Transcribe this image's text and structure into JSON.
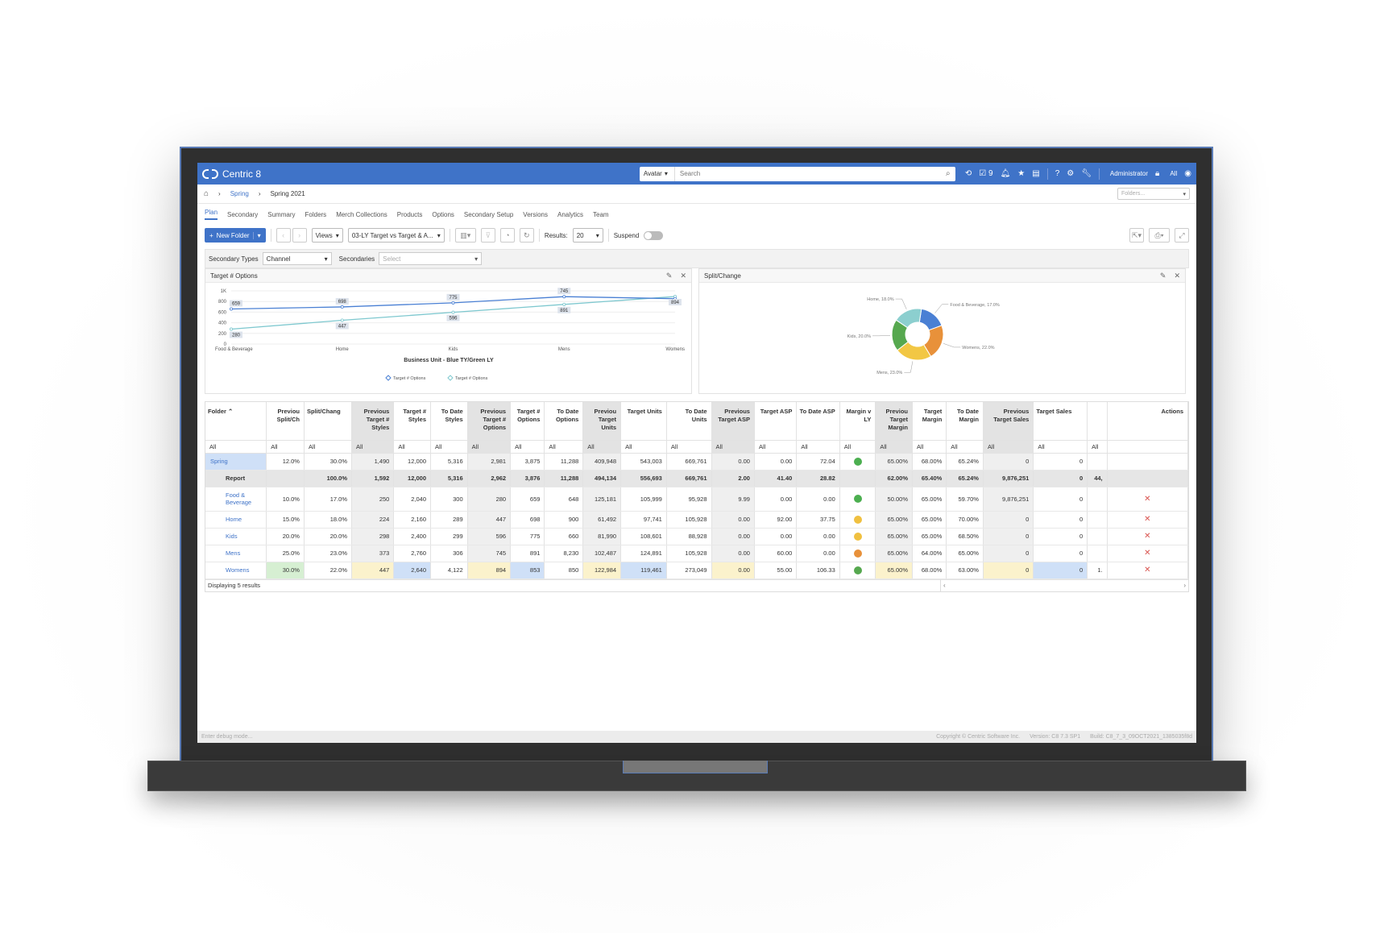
{
  "app": {
    "title": "Centric 8"
  },
  "search": {
    "scope": "Avatar",
    "placeholder": "Search"
  },
  "topbar": {
    "notification_count": "9",
    "user": "Administrator",
    "lock_scope": "All"
  },
  "breadcrumb": {
    "season": "Spring",
    "current": "Spring 2021",
    "folders_placeholder": "Folders..."
  },
  "tabs": [
    "Plan",
    "Secondary",
    "Summary",
    "Folders",
    "Merch Collections",
    "Products",
    "Options",
    "Secondary Setup",
    "Versions",
    "Analytics",
    "Team"
  ],
  "toolbar": {
    "new_folder": "New Folder",
    "views_label": "Views",
    "view_value": "03-LY Target vs Target & A...",
    "results_label": "Results:",
    "results_value": "20",
    "suspend_label": "Suspend"
  },
  "filters": {
    "secondary_types_label": "Secondary Types",
    "secondary_types_value": "Channel",
    "secondaries_label": "Secondaries",
    "secondaries_placeholder": "Select"
  },
  "line_panel": {
    "title": "Target # Options"
  },
  "pie_panel": {
    "title": "Split/Change"
  },
  "chart_data": [
    {
      "type": "line",
      "title": "Business Unit - Blue TY/Green LY",
      "categories": [
        "Food & Beverage",
        "Home",
        "Kids",
        "Mens",
        "Womens"
      ],
      "y_ticks": [
        "0",
        "200",
        "400",
        "600",
        "800",
        "1K"
      ],
      "ylim": [
        0,
        1000
      ],
      "grid": true,
      "legend_position": "bottom",
      "legend": [
        "Target # Options",
        "Target # Options"
      ],
      "series": [
        {
          "name": "Target # Options",
          "color": "#4a80d4",
          "values": [
            659,
            698,
            775,
            891,
            853
          ]
        },
        {
          "name": "Target # Options",
          "color": "#7ec8cf",
          "values": [
            280,
            447,
            596,
            745,
            894
          ]
        }
      ],
      "data_labels": [
        {
          "series": 0,
          "index": 0,
          "text": "659"
        },
        {
          "series": 1,
          "index": 0,
          "text": "280"
        },
        {
          "series": 0,
          "index": 1,
          "text": "698"
        },
        {
          "series": 1,
          "index": 1,
          "text": "447"
        },
        {
          "series": 0,
          "index": 2,
          "text": "775"
        },
        {
          "series": 1,
          "index": 2,
          "text": "596"
        },
        {
          "series": 0,
          "index": 3,
          "text": "745"
        },
        {
          "series": 1,
          "index": 3,
          "text": "891"
        },
        {
          "series": 1,
          "index": 4,
          "text": "894"
        }
      ]
    },
    {
      "type": "pie",
      "slices": [
        {
          "label": "Food & Beverage, 17.0%",
          "value": 17.0,
          "color": "#4a80d4"
        },
        {
          "label": "Womens, 22.0%",
          "value": 22.0,
          "color": "#e8913a"
        },
        {
          "label": "Mens, 23.0%",
          "value": 23.0,
          "color": "#f2c744"
        },
        {
          "label": "Kids, 20.0%",
          "value": 20.0,
          "color": "#56a84f"
        },
        {
          "label": "Home, 18.0%",
          "value": 18.0,
          "color": "#8ccfcf"
        }
      ]
    }
  ],
  "grid": {
    "columns": [
      {
        "label": "Folder",
        "shade": false
      },
      {
        "label": "Previou Split/Ch",
        "shade": false
      },
      {
        "label": "Split/Chang",
        "shade": false
      },
      {
        "label": "Previous Target # Styles",
        "shade": true
      },
      {
        "label": "Target # Styles",
        "shade": false
      },
      {
        "label": "To Date Styles",
        "shade": false
      },
      {
        "label": "Previous Target # Options",
        "shade": true
      },
      {
        "label": "Target # Options",
        "shade": false
      },
      {
        "label": "To Date Options",
        "shade": false
      },
      {
        "label": "Previou Target Units",
        "shade": true
      },
      {
        "label": "Target Units",
        "shade": false
      },
      {
        "label": "To Date Units",
        "shade": false
      },
      {
        "label": "Previous Target ASP",
        "shade": true
      },
      {
        "label": "Target ASP",
        "shade": false
      },
      {
        "label": "To Date ASP",
        "shade": false
      },
      {
        "label": "Margin v LY",
        "shade": false
      },
      {
        "label": "Previou Target Margin",
        "shade": true
      },
      {
        "label": "Target Margin",
        "shade": false
      },
      {
        "label": "To Date Margin",
        "shade": false
      },
      {
        "label": "Previous Target Sales",
        "shade": true
      },
      {
        "label": "Target Sales",
        "shade": false
      },
      {
        "label": "",
        "shade": false
      },
      {
        "label": "Actions",
        "shade": false
      }
    ],
    "filter_value": "All",
    "footer": "Displaying 5 results",
    "rows": [
      {
        "name": "Spring",
        "kind": "top",
        "cells": [
          "12.0%",
          "30.0%",
          "1,490",
          "12,000",
          "5,316",
          "2,981",
          "3,875",
          "11,288",
          "409,948",
          "543,003",
          "669,761",
          "0.00",
          "0.00",
          "72.04",
          "",
          "65.00%",
          "68.00%",
          "65.24%",
          "0",
          "0",
          "",
          ""
        ],
        "margin_icon": "arrow-up-icon",
        "margin_color": "#4caf50"
      },
      {
        "name": "Report",
        "kind": "report",
        "cells": [
          "",
          "100.0%",
          "1,592",
          "12,000",
          "5,316",
          "2,962",
          "3,876",
          "11,288",
          "494,134",
          "556,693",
          "669,761",
          "2.00",
          "41.40",
          "28.82",
          "",
          "62.00%",
          "65.40%",
          "65.24%",
          "9,876,251",
          "0",
          "44,",
          ""
        ]
      },
      {
        "name": "Food & Beverage",
        "kind": "sub",
        "cells": [
          "10.0%",
          "17.0%",
          "250",
          "2,040",
          "300",
          "280",
          "659",
          "648",
          "125,181",
          "105,999",
          "95,928",
          "9.99",
          "0.00",
          "0.00",
          "",
          "50.00%",
          "65.00%",
          "59.70%",
          "9,876,251",
          "0",
          "",
          ""
        ],
        "margin_icon": "arrow-up-icon",
        "margin_color": "#4caf50",
        "action": "✕"
      },
      {
        "name": "Home",
        "kind": "sub",
        "cells": [
          "15.0%",
          "18.0%",
          "224",
          "2,160",
          "289",
          "447",
          "698",
          "900",
          "61,492",
          "97,741",
          "105,928",
          "0.00",
          "92.00",
          "37.75",
          "",
          "65.00%",
          "65.00%",
          "70.00%",
          "0",
          "0",
          "",
          ""
        ],
        "margin_icon": "neutral-icon",
        "margin_color": "#f0c040",
        "action": "✕"
      },
      {
        "name": "Kids",
        "kind": "sub",
        "cells": [
          "20.0%",
          "20.0%",
          "298",
          "2,400",
          "299",
          "596",
          "775",
          "660",
          "81,990",
          "108,601",
          "88,928",
          "0.00",
          "0.00",
          "0.00",
          "",
          "65.00%",
          "65.00%",
          "68.50%",
          "0",
          "0",
          "",
          ""
        ],
        "margin_icon": "neutral-icon",
        "margin_color": "#f0c040",
        "action": "✕"
      },
      {
        "name": "Mens",
        "kind": "sub",
        "cells": [
          "25.0%",
          "23.0%",
          "373",
          "2,760",
          "306",
          "745",
          "891",
          "8,230",
          "102,487",
          "124,891",
          "105,928",
          "0.00",
          "60.00",
          "0.00",
          "",
          "65.00%",
          "64.00%",
          "65.00%",
          "0",
          "0",
          "",
          ""
        ],
        "margin_icon": "arrow-down-icon",
        "margin_color": "#e8913a",
        "action": "✕"
      },
      {
        "name": "Womens",
        "kind": "sub",
        "cells": [
          "30.0%",
          "22.0%",
          "447",
          "2,640",
          "4,122",
          "894",
          "853",
          "850",
          "122,984",
          "119,461",
          "273,049",
          "0.00",
          "55.00",
          "106.33",
          "",
          "65.00%",
          "68.00%",
          "63.00%",
          "0",
          "0",
          "1.",
          ""
        ],
        "margin_icon": "arrow-up-icon",
        "margin_color": "#56a84f",
        "action": "✕"
      }
    ]
  },
  "footer": {
    "debug": "Enter debug mode...",
    "copyright": "Copyright © Centric Software Inc.",
    "version": "Version: C8 7.3 SP1",
    "build": "Build: C8_7_3_09OCT2021_1385035f8d"
  }
}
